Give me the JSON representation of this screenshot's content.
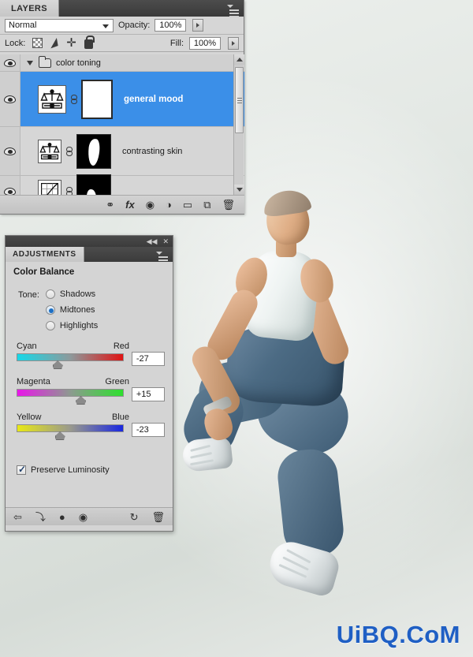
{
  "layers_panel": {
    "tab_label": "LAYERS",
    "menu_icon": "panel-menu-icon",
    "blend_mode": "Normal",
    "opacity_label": "Opacity:",
    "opacity_value": "100%",
    "lock_label": "Lock:",
    "lock_icons": [
      "lock-transparent-pixels-icon",
      "lock-image-pixels-icon",
      "lock-position-icon",
      "lock-all-icon"
    ],
    "fill_label": "Fill:",
    "fill_value": "100%",
    "group": {
      "name": "color toning",
      "expanded": true
    },
    "layers": [
      {
        "name": "general mood",
        "selected": true,
        "visible": true,
        "type": "color-balance",
        "mask": "white"
      },
      {
        "name": "contrasting skin",
        "selected": false,
        "visible": true,
        "type": "color-balance",
        "mask": "black"
      },
      {
        "name": "",
        "selected": false,
        "visible": true,
        "type": "curves",
        "mask": "black"
      }
    ],
    "footer_icons": [
      "link-layers-icon",
      "layer-style-fx-icon",
      "add-layer-mask-icon",
      "new-fill-adjustment-icon",
      "new-group-icon",
      "new-layer-icon",
      "delete-layer-icon"
    ],
    "footer_glyphs": [
      "⚭",
      "fx",
      "◉",
      "◑",
      "▭",
      "⧉",
      "🗑"
    ]
  },
  "adjustments_panel": {
    "tab_label": "ADJUSTMENTS",
    "collapse_glyph": "◀◀",
    "close_glyph": "✕",
    "menu_icon": "panel-menu-icon",
    "heading": "Color Balance",
    "tone_label": "Tone:",
    "tone_options": [
      {
        "label": "Shadows",
        "selected": false
      },
      {
        "label": "Midtones",
        "selected": true
      },
      {
        "label": "Highlights",
        "selected": false
      }
    ],
    "sliders": [
      {
        "left_label": "Cyan",
        "right_label": "Red",
        "value": "-27",
        "knob_pct": 36.5
      },
      {
        "left_label": "Magenta",
        "right_label": "Green",
        "value": "+15",
        "knob_pct": 57.0
      },
      {
        "left_label": "Yellow",
        "right_label": "Blue",
        "value": "-23",
        "knob_pct": 38.5
      }
    ],
    "preserve_luminosity": {
      "label": "Preserve Luminosity",
      "checked": true
    },
    "footer_icons": [
      "return-to-adjustment-list-icon",
      "clip-to-layer-icon",
      "toggle-layer-visibility-icon",
      "view-previous-state-icon",
      "reset-icon",
      "delete-adjustment-icon"
    ],
    "footer_glyphs": [
      "⇦",
      "⤵",
      "●",
      "◉",
      "↻",
      "🗑"
    ]
  },
  "canvas": {
    "watermark": "UiBQ.CoM",
    "watermark_color": "#1f5fc4",
    "subject": "dancer-photo"
  }
}
